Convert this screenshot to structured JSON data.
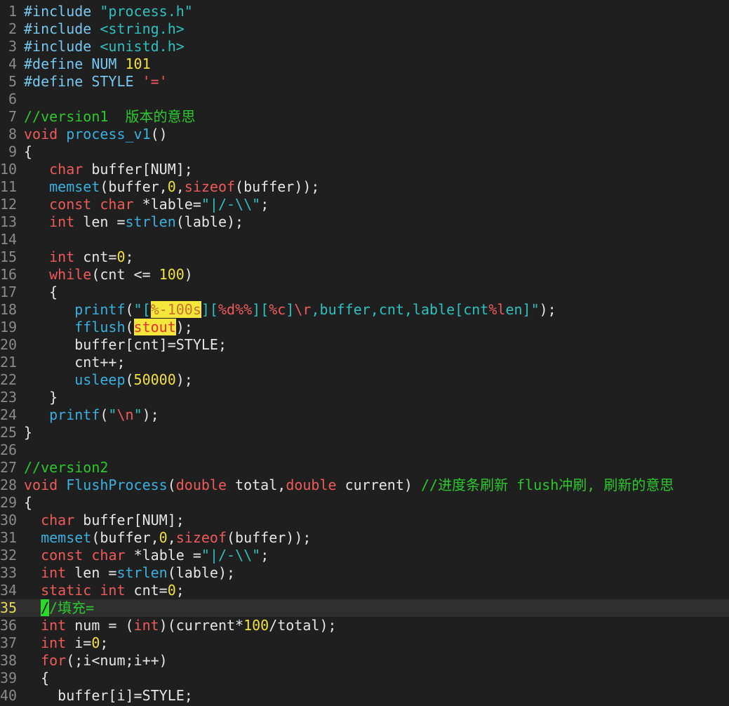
{
  "editor": {
    "current_line": 35,
    "lines": [
      {
        "n": "1",
        "tokens": [
          [
            "preproc",
            "#include "
          ],
          [
            "string",
            "\"process.h\""
          ]
        ]
      },
      {
        "n": "2",
        "tokens": [
          [
            "preproc",
            "#include "
          ],
          [
            "string",
            "<string.h>"
          ]
        ]
      },
      {
        "n": "3",
        "tokens": [
          [
            "preproc",
            "#include "
          ],
          [
            "string",
            "<unistd.h>"
          ]
        ]
      },
      {
        "n": "4",
        "tokens": [
          [
            "preproc",
            "#define NUM "
          ],
          [
            "number",
            "101"
          ]
        ]
      },
      {
        "n": "5",
        "tokens": [
          [
            "preproc",
            "#define STYLE "
          ],
          [
            "escape",
            "'='"
          ]
        ]
      },
      {
        "n": "6",
        "tokens": []
      },
      {
        "n": "7",
        "tokens": [
          [
            "comment",
            "//version1  版本的意思"
          ]
        ]
      },
      {
        "n": "8",
        "tokens": [
          [
            "type",
            "void "
          ],
          [
            "func",
            "process_v1"
          ],
          [
            "default",
            "()"
          ]
        ]
      },
      {
        "n": "9",
        "tokens": [
          [
            "default",
            "{"
          ]
        ]
      },
      {
        "n": "10",
        "tokens": [
          [
            "default",
            "   "
          ],
          [
            "type",
            "char"
          ],
          [
            "default",
            " buffer[NUM];"
          ]
        ]
      },
      {
        "n": "11",
        "tokens": [
          [
            "default",
            "   "
          ],
          [
            "func",
            "memset"
          ],
          [
            "default",
            "(buffer,"
          ],
          [
            "number",
            "0"
          ],
          [
            "default",
            ","
          ],
          [
            "keyword",
            "sizeof"
          ],
          [
            "default",
            "(buffer));"
          ]
        ]
      },
      {
        "n": "12",
        "tokens": [
          [
            "default",
            "   "
          ],
          [
            "type",
            "const"
          ],
          [
            "default",
            " "
          ],
          [
            "type",
            "char"
          ],
          [
            "default",
            " *lable="
          ],
          [
            "string",
            "\"|/-\\\\\""
          ],
          [
            "default",
            ";"
          ]
        ]
      },
      {
        "n": "13",
        "tokens": [
          [
            "default",
            "   "
          ],
          [
            "type",
            "int"
          ],
          [
            "default",
            " len ="
          ],
          [
            "func",
            "strlen"
          ],
          [
            "default",
            "(lable);"
          ]
        ]
      },
      {
        "n": "14",
        "tokens": []
      },
      {
        "n": "15",
        "tokens": [
          [
            "default",
            "   "
          ],
          [
            "type",
            "int"
          ],
          [
            "default",
            " cnt="
          ],
          [
            "number",
            "0"
          ],
          [
            "default",
            ";"
          ]
        ]
      },
      {
        "n": "16",
        "tokens": [
          [
            "default",
            "   "
          ],
          [
            "keyword",
            "while"
          ],
          [
            "default",
            "(cnt <= "
          ],
          [
            "number",
            "100"
          ],
          [
            "default",
            ")"
          ]
        ]
      },
      {
        "n": "17",
        "tokens": [
          [
            "default",
            "   {"
          ]
        ]
      },
      {
        "n": "18",
        "tokens": [
          [
            "default",
            "      "
          ],
          [
            "func",
            "printf"
          ],
          [
            "default",
            "("
          ],
          [
            "string",
            "\"["
          ],
          [
            "hlfmt",
            "%-100s"
          ],
          [
            "string",
            "]["
          ],
          [
            "format",
            "%d%%"
          ],
          [
            "string",
            "]["
          ],
          [
            "format",
            "%c"
          ],
          [
            "string",
            "]"
          ],
          [
            "escape",
            "\\r"
          ],
          [
            "string",
            ",buffer,cnt,lable[cnt"
          ],
          [
            "format",
            "%l"
          ],
          [
            "string",
            "en]\""
          ],
          [
            "default",
            ");"
          ]
        ]
      },
      {
        "n": "19",
        "tokens": [
          [
            "default",
            "      "
          ],
          [
            "func",
            "fflush"
          ],
          [
            "default",
            "("
          ],
          [
            "hl",
            "stout"
          ],
          [
            "default",
            ");"
          ]
        ]
      },
      {
        "n": "20",
        "tokens": [
          [
            "default",
            "      buffer[cnt]=STYLE;"
          ]
        ]
      },
      {
        "n": "21",
        "tokens": [
          [
            "default",
            "      cnt++;"
          ]
        ]
      },
      {
        "n": "22",
        "tokens": [
          [
            "default",
            "      "
          ],
          [
            "func",
            "usleep"
          ],
          [
            "default",
            "("
          ],
          [
            "number",
            "50000"
          ],
          [
            "default",
            ");"
          ]
        ]
      },
      {
        "n": "23",
        "tokens": [
          [
            "default",
            "   }"
          ]
        ]
      },
      {
        "n": "24",
        "tokens": [
          [
            "default",
            "   "
          ],
          [
            "func",
            "printf"
          ],
          [
            "default",
            "("
          ],
          [
            "string",
            "\""
          ],
          [
            "escape",
            "\\n"
          ],
          [
            "string",
            "\""
          ],
          [
            "default",
            ");"
          ]
        ]
      },
      {
        "n": "25",
        "tokens": [
          [
            "default",
            "}"
          ]
        ]
      },
      {
        "n": "26",
        "tokens": []
      },
      {
        "n": "27",
        "tokens": [
          [
            "comment",
            "//version2"
          ]
        ]
      },
      {
        "n": "28",
        "tokens": [
          [
            "type",
            "void "
          ],
          [
            "func",
            "FlushProcess"
          ],
          [
            "default",
            "("
          ],
          [
            "type",
            "double"
          ],
          [
            "default",
            " total,"
          ],
          [
            "type",
            "double"
          ],
          [
            "default",
            " current) "
          ],
          [
            "comment",
            "//进度条刷新 flush冲刷, 刷新的意思"
          ]
        ]
      },
      {
        "n": "29",
        "tokens": [
          [
            "default",
            "{"
          ]
        ]
      },
      {
        "n": "30",
        "tokens": [
          [
            "default",
            "  "
          ],
          [
            "type",
            "char"
          ],
          [
            "default",
            " buffer[NUM];"
          ]
        ]
      },
      {
        "n": "31",
        "tokens": [
          [
            "default",
            "  "
          ],
          [
            "func",
            "memset"
          ],
          [
            "default",
            "(buffer,"
          ],
          [
            "number",
            "0"
          ],
          [
            "default",
            ","
          ],
          [
            "keyword",
            "sizeof"
          ],
          [
            "default",
            "(buffer));"
          ]
        ]
      },
      {
        "n": "32",
        "tokens": [
          [
            "default",
            "  "
          ],
          [
            "type",
            "const"
          ],
          [
            "default",
            " "
          ],
          [
            "type",
            "char"
          ],
          [
            "default",
            " *lable ="
          ],
          [
            "string",
            "\"|/-\\\\\""
          ],
          [
            "default",
            ";"
          ]
        ]
      },
      {
        "n": "33",
        "tokens": [
          [
            "default",
            "  "
          ],
          [
            "type",
            "int"
          ],
          [
            "default",
            " len ="
          ],
          [
            "func",
            "strlen"
          ],
          [
            "default",
            "(lable);"
          ]
        ]
      },
      {
        "n": "34",
        "tokens": [
          [
            "default",
            "  "
          ],
          [
            "type",
            "static"
          ],
          [
            "default",
            " "
          ],
          [
            "type",
            "int"
          ],
          [
            "default",
            " cnt="
          ],
          [
            "number",
            "0"
          ],
          [
            "default",
            ";"
          ]
        ]
      },
      {
        "n": "35",
        "tokens": [
          [
            "default",
            "  "
          ],
          [
            "cursor",
            "/"
          ],
          [
            "comment",
            "/填充="
          ]
        ]
      },
      {
        "n": "36",
        "tokens": [
          [
            "default",
            "  "
          ],
          [
            "type",
            "int"
          ],
          [
            "default",
            " num = ("
          ],
          [
            "type",
            "int"
          ],
          [
            "default",
            ")(current*"
          ],
          [
            "number",
            "100"
          ],
          [
            "default",
            "/total);"
          ]
        ]
      },
      {
        "n": "37",
        "tokens": [
          [
            "default",
            "  "
          ],
          [
            "type",
            "int"
          ],
          [
            "default",
            " i="
          ],
          [
            "number",
            "0"
          ],
          [
            "default",
            ";"
          ]
        ]
      },
      {
        "n": "38",
        "tokens": [
          [
            "default",
            "  "
          ],
          [
            "keyword",
            "for"
          ],
          [
            "default",
            "(;i<num;i++)"
          ]
        ]
      },
      {
        "n": "39",
        "tokens": [
          [
            "default",
            "  {"
          ]
        ]
      },
      {
        "n": "40",
        "tokens": [
          [
            "default",
            "    buffer[i]=STYLE;"
          ]
        ]
      }
    ]
  }
}
